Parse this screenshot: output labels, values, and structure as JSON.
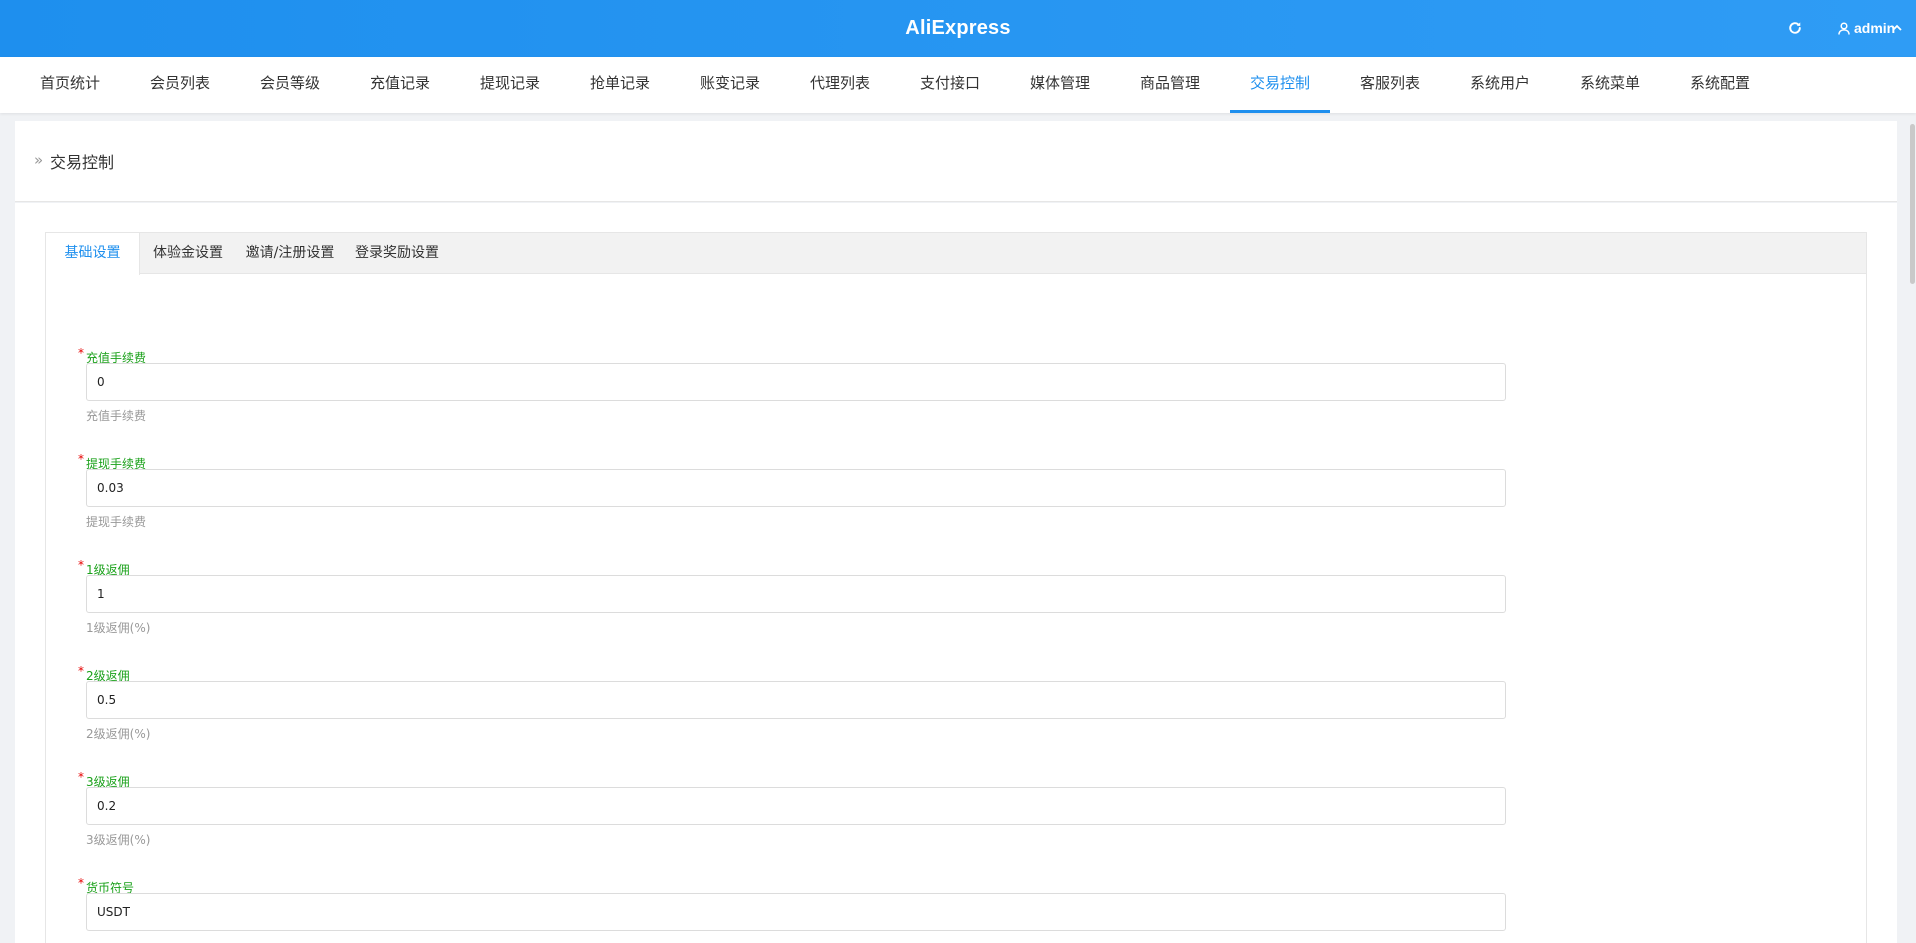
{
  "header": {
    "brand": "AliExpress",
    "user": "admin",
    "refresh_icon": "refresh-icon",
    "user_icon": "user-icon"
  },
  "nav": {
    "items": [
      {
        "label": "首页统计"
      },
      {
        "label": "会员列表"
      },
      {
        "label": "会员等级"
      },
      {
        "label": "充值记录"
      },
      {
        "label": "提现记录"
      },
      {
        "label": "抢单记录"
      },
      {
        "label": "账变记录"
      },
      {
        "label": "代理列表"
      },
      {
        "label": "支付接口"
      },
      {
        "label": "媒体管理"
      },
      {
        "label": "商品管理"
      },
      {
        "label": "交易控制"
      },
      {
        "label": "客服列表"
      },
      {
        "label": "系统用户"
      },
      {
        "label": "系统菜单"
      },
      {
        "label": "系统配置"
      }
    ],
    "active": "交易控制"
  },
  "breadcrumb": {
    "arrow": "»",
    "title": "交易控制"
  },
  "tabs": [
    {
      "label": "基础设置",
      "active": true
    },
    {
      "label": "体验金设置"
    },
    {
      "label": "邀请/注册设置"
    },
    {
      "label": "登录奖励设置"
    }
  ],
  "form": {
    "required_mark": "*",
    "fields": [
      {
        "label": "充值手续费",
        "value": "0",
        "help": "充值手续费"
      },
      {
        "label": "提现手续费",
        "value": "0.03",
        "help": "提现手续费"
      },
      {
        "label": "1级返佣",
        "value": "1",
        "help": "1级返佣(%)"
      },
      {
        "label": "2级返佣",
        "value": "0.5",
        "help": "2级返佣(%)"
      },
      {
        "label": "3级返佣",
        "value": "0.2",
        "help": "3级返佣(%)"
      },
      {
        "label": "货币符号",
        "value": "USDT",
        "help": ""
      }
    ]
  },
  "colors": {
    "primary": "#1e8fee",
    "label_green": "#1aa11a",
    "required_red": "#e60000"
  }
}
